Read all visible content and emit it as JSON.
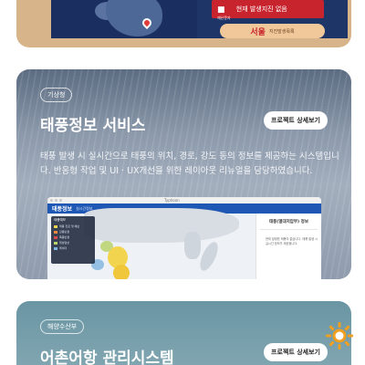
{
  "top_card": {
    "alert_sub": "재난문자",
    "alert_text": "현재 발생지진 없음",
    "city": "서울",
    "city_label": "지진발생목록"
  },
  "main_card": {
    "tag": "기상청",
    "title": "태풍정보 서비스",
    "detail_button": "프로젝트 상세보기",
    "description": "태풍 발생 시 실시간으로 태풍의 위치, 경로, 강도 등의 정보를 제공하는 시스템입니다. 반응형 작업 및 UI · UX개선을 위한 레이아웃 리뉴얼을 담당하였습니다.",
    "mockup": {
      "url": "Typhoon",
      "logo": "태풍정보",
      "header_sub": "실시간정보",
      "legend_title": "태풍예보",
      "legend_items": [
        "태풍 진로 및 예보",
        "강풍반경",
        "폭풍반경",
        "위성영상",
        "레이더"
      ],
      "panel_title": "태풍(열대저압부) 정보",
      "panel_text": "현재 발생한 태풍이 없습니다. 태풍 발생 시 실시간 정보가 제공됩니다."
    }
  },
  "bottom_card": {
    "tag": "해양수산부",
    "title": "어촌어항 관리시스템",
    "detail_button": "프로젝트 상세보기"
  },
  "colors": {
    "alert_red": "#c8242e",
    "mock_header_blue": "#1f58b4",
    "sun_orange": "#f0a020"
  }
}
